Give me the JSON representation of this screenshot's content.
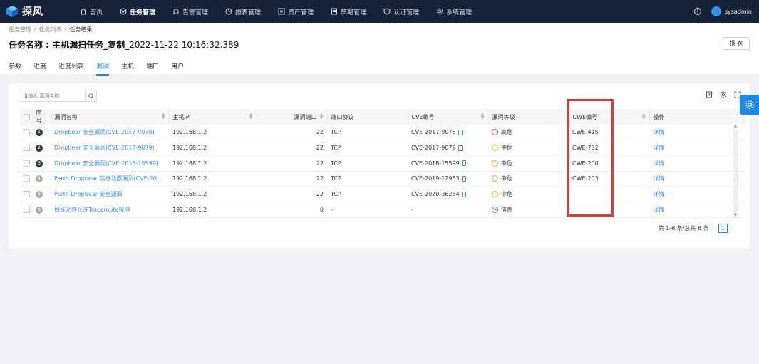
{
  "app": {
    "name": "探风",
    "logo_icon": "cube-logo-icon"
  },
  "nav": {
    "items": [
      {
        "label": "首页",
        "icon": "home-icon"
      },
      {
        "label": "任务管理",
        "icon": "task-icon",
        "active": true
      },
      {
        "label": "告警管理",
        "icon": "alarm-icon"
      },
      {
        "label": "报表管理",
        "icon": "chart-icon"
      },
      {
        "label": "资产管理",
        "icon": "asset-icon"
      },
      {
        "label": "策略管理",
        "icon": "strategy-icon"
      },
      {
        "label": "认证管理",
        "icon": "shield-icon"
      },
      {
        "label": "系统管理",
        "icon": "gear-icon"
      }
    ],
    "user": "sysadmin",
    "help": "?"
  },
  "breadcrumb": [
    "任务管理",
    "/",
    "任务列表",
    "/",
    "任务结果"
  ],
  "page": {
    "title_label": "任务名称 : 主机漏扫任务_复制",
    "title_time": "_2022-11-22 10:16:32.389",
    "report_btn": "报 表"
  },
  "tabs": [
    "参数",
    "进度",
    "进度列表",
    "漏洞",
    "主机",
    "端口",
    "用户"
  ],
  "active_tab": 3,
  "search": {
    "placeholder": "请输入 漏洞名称"
  },
  "table": {
    "headers": [
      "序号",
      "漏洞名称",
      "主机IP",
      "漏洞端口",
      "端口协议",
      "CVE编号",
      "漏洞等级",
      "CWE编号",
      "操作"
    ],
    "rows": [
      {
        "no": "1",
        "name": "Dropbear 安全漏洞(CVE-2017-9078)",
        "ip": "192.168.1.2",
        "port": "22",
        "proto": "TCP",
        "cve": "CVE-2017-9078",
        "level": "高危",
        "level_color": "#e53935",
        "cwe": "CWE-415",
        "op": "详情"
      },
      {
        "no": "2",
        "name": "Dropbear 安全漏洞(CVE-2017-9079)",
        "ip": "192.168.1.2",
        "port": "22",
        "proto": "TCP",
        "cve": "CVE-2017-9079",
        "level": "中危",
        "level_color": "#f5a623",
        "cwe": "CWE-732",
        "op": "详情"
      },
      {
        "no": "3",
        "name": "Dropbear 安全漏洞(CVE-2018-15599)",
        "ip": "192.168.1.2",
        "port": "22",
        "proto": "TCP",
        "cve": "CVE-2018-15599",
        "level": "中危",
        "level_color": "#f5a623",
        "cwe": "CWE-200",
        "op": "详情"
      },
      {
        "no": "4",
        "name": "Perth Dropbear 信息泄露漏洞(CVE-2019-12...",
        "ip": "192.168.1.2",
        "port": "22",
        "proto": "TCP",
        "cve": "CVE-2019-12953",
        "level": "中危",
        "level_color": "#f5a623",
        "cwe": "CWE-203",
        "op": "详情"
      },
      {
        "no": "5",
        "name": "Perth Dropbear 安全漏洞",
        "ip": "192.168.1.2",
        "port": "22",
        "proto": "TCP",
        "cve": "CVE-2020-36254",
        "level": "中危",
        "level_color": "#f5a623",
        "cwe": "",
        "op": "详情"
      },
      {
        "no": "6",
        "name": "目标允许允许Traceroute探测",
        "ip": "192.168.1.2",
        "port": "0",
        "proto": "-",
        "cve": "-",
        "level": "信息",
        "level_color": "#3a8ee6",
        "cwe": "",
        "op": "详情"
      }
    ]
  },
  "pagination": {
    "summary": "第 1-6 条/总共 6 条",
    "current": "1"
  },
  "colors": {
    "nav_bg": "#16213a",
    "accent": "#1e88e5",
    "highlight": "#e53935"
  }
}
